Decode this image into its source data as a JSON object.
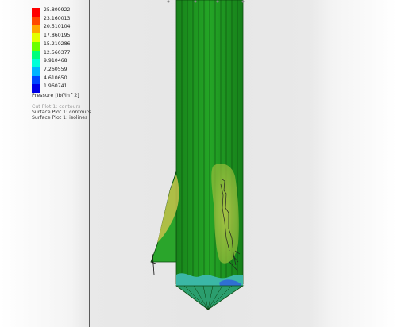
{
  "legend": {
    "ticks": [
      "25.809922",
      "23.160013",
      "20.510104",
      "17.860195",
      "15.210286",
      "12.560377",
      "9.910468",
      "7.260559",
      "4.610650",
      "1.960741"
    ],
    "colors": [
      "#ff0000",
      "#ff4800",
      "#ffa600",
      "#e4ff00",
      "#6aff00",
      "#00ff7c",
      "#00ffd8",
      "#00b4ff",
      "#0046ff",
      "#0000e6"
    ],
    "unit": "Pressure [lbf/in^2]"
  },
  "plot_info": {
    "cut_plot": "Cut Plot 1: contours",
    "surface_contours": "Surface Plot 1: contours",
    "surface_isolines": "Surface Plot 1: isolines"
  }
}
